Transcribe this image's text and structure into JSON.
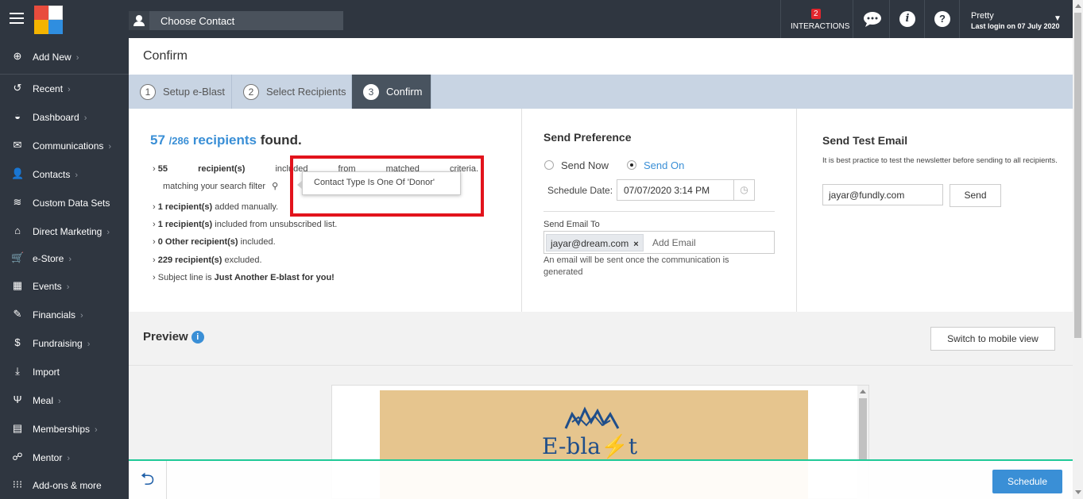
{
  "topbar": {
    "choose_contact": "Choose Contact",
    "interactions_count": "2",
    "interactions_label": "INTERACTIONS",
    "user_name": "Pretty",
    "last_login": "Last login on 07 July 2020",
    "icons": [
      "menu-icon",
      "chat-icon",
      "info-icon",
      "help-icon"
    ]
  },
  "sidebar": {
    "items": [
      {
        "label": "Add New",
        "chevron": "›",
        "icon": "plus-circle-icon"
      },
      {
        "label": "Recent",
        "chevron": "›",
        "icon": "history-icon"
      },
      {
        "label": "Dashboard",
        "chevron": "›",
        "icon": "dashboard-icon"
      },
      {
        "label": "Communications",
        "chevron": "›",
        "icon": "envelope-icon"
      },
      {
        "label": "Contacts",
        "chevron": "›",
        "icon": "user-icon"
      },
      {
        "label": "Custom Data Sets",
        "chevron": "",
        "icon": "stack-icon"
      },
      {
        "label": "Direct Marketing",
        "chevron": "›",
        "icon": "home-icon"
      },
      {
        "label": "e-Store",
        "chevron": "›",
        "icon": "cart-icon"
      },
      {
        "label": "Events",
        "chevron": "›",
        "icon": "calendar-icon"
      },
      {
        "label": "Financials",
        "chevron": "›",
        "icon": "money-icon"
      },
      {
        "label": "Fundraising",
        "chevron": "›",
        "icon": "moneybag-icon"
      },
      {
        "label": "Import",
        "chevron": "",
        "icon": "import-icon"
      },
      {
        "label": "Meal",
        "chevron": "›",
        "icon": "fork-knife-icon"
      },
      {
        "label": "Memberships",
        "chevron": "›",
        "icon": "id-card-icon"
      },
      {
        "label": "Mentor",
        "chevron": "›",
        "icon": "mentor-icon"
      },
      {
        "label": "Add-ons & more",
        "chevron": "",
        "icon": "grid-icon"
      }
    ]
  },
  "page": {
    "title": "Confirm"
  },
  "steps": [
    {
      "num": "1",
      "label": "Setup e-Blast"
    },
    {
      "num": "2",
      "label": "Select Recipients"
    },
    {
      "num": "3",
      "label": "Confirm"
    }
  ],
  "recipients": {
    "count": "57",
    "total": "/286",
    "label": "recipients",
    "found": "found.",
    "criteria_count": "55",
    "criteria_word1": "recipient(s)",
    "criteria_word2": "included",
    "criteria_word3": "from",
    "criteria_word4": "matched",
    "criteria_word5": "criteria.",
    "criteria_line2": "matching your search filter",
    "manual_count": "1 recipient(s)",
    "manual_text": "added manually.",
    "unsub_count": "1 recipient(s)",
    "unsub_text": "included from unsubscribed list.",
    "other_count": "0 Other recipient(s)",
    "other_text": "included.",
    "excluded_count": "229 recipient(s)",
    "excluded_text": "excluded.",
    "subject_prefix": "Subject line is",
    "subject": "Just Another E-blast for you!",
    "tooltip": "Contact Type Is One Of 'Donor'"
  },
  "send_preference": {
    "title": "Send Preference",
    "send_now": "Send Now",
    "send_on": "Send On",
    "schedule_label": "Schedule Date:",
    "schedule_value": "07/07/2020 3:14 PM",
    "send_email_to": "Send Email To",
    "email_chip": "jayar@dream.com",
    "add_email_placeholder": "Add Email",
    "note": "An email will be sent once the communication is generated"
  },
  "test_email": {
    "title": "Send Test Email",
    "desc": "It is best practice to test the newsletter before sending to all recipients.",
    "value": "jayar@fundly.com",
    "send": "Send"
  },
  "preview": {
    "title": "Preview",
    "switch": "Switch to mobile view",
    "banner_text": "E-bla⚡t"
  },
  "bottom": {
    "schedule": "Schedule"
  },
  "colors": {
    "accent": "#3a8fd6",
    "dark": "#2f3640",
    "highlight": "#e2131c",
    "banner": "#e6c58e"
  }
}
